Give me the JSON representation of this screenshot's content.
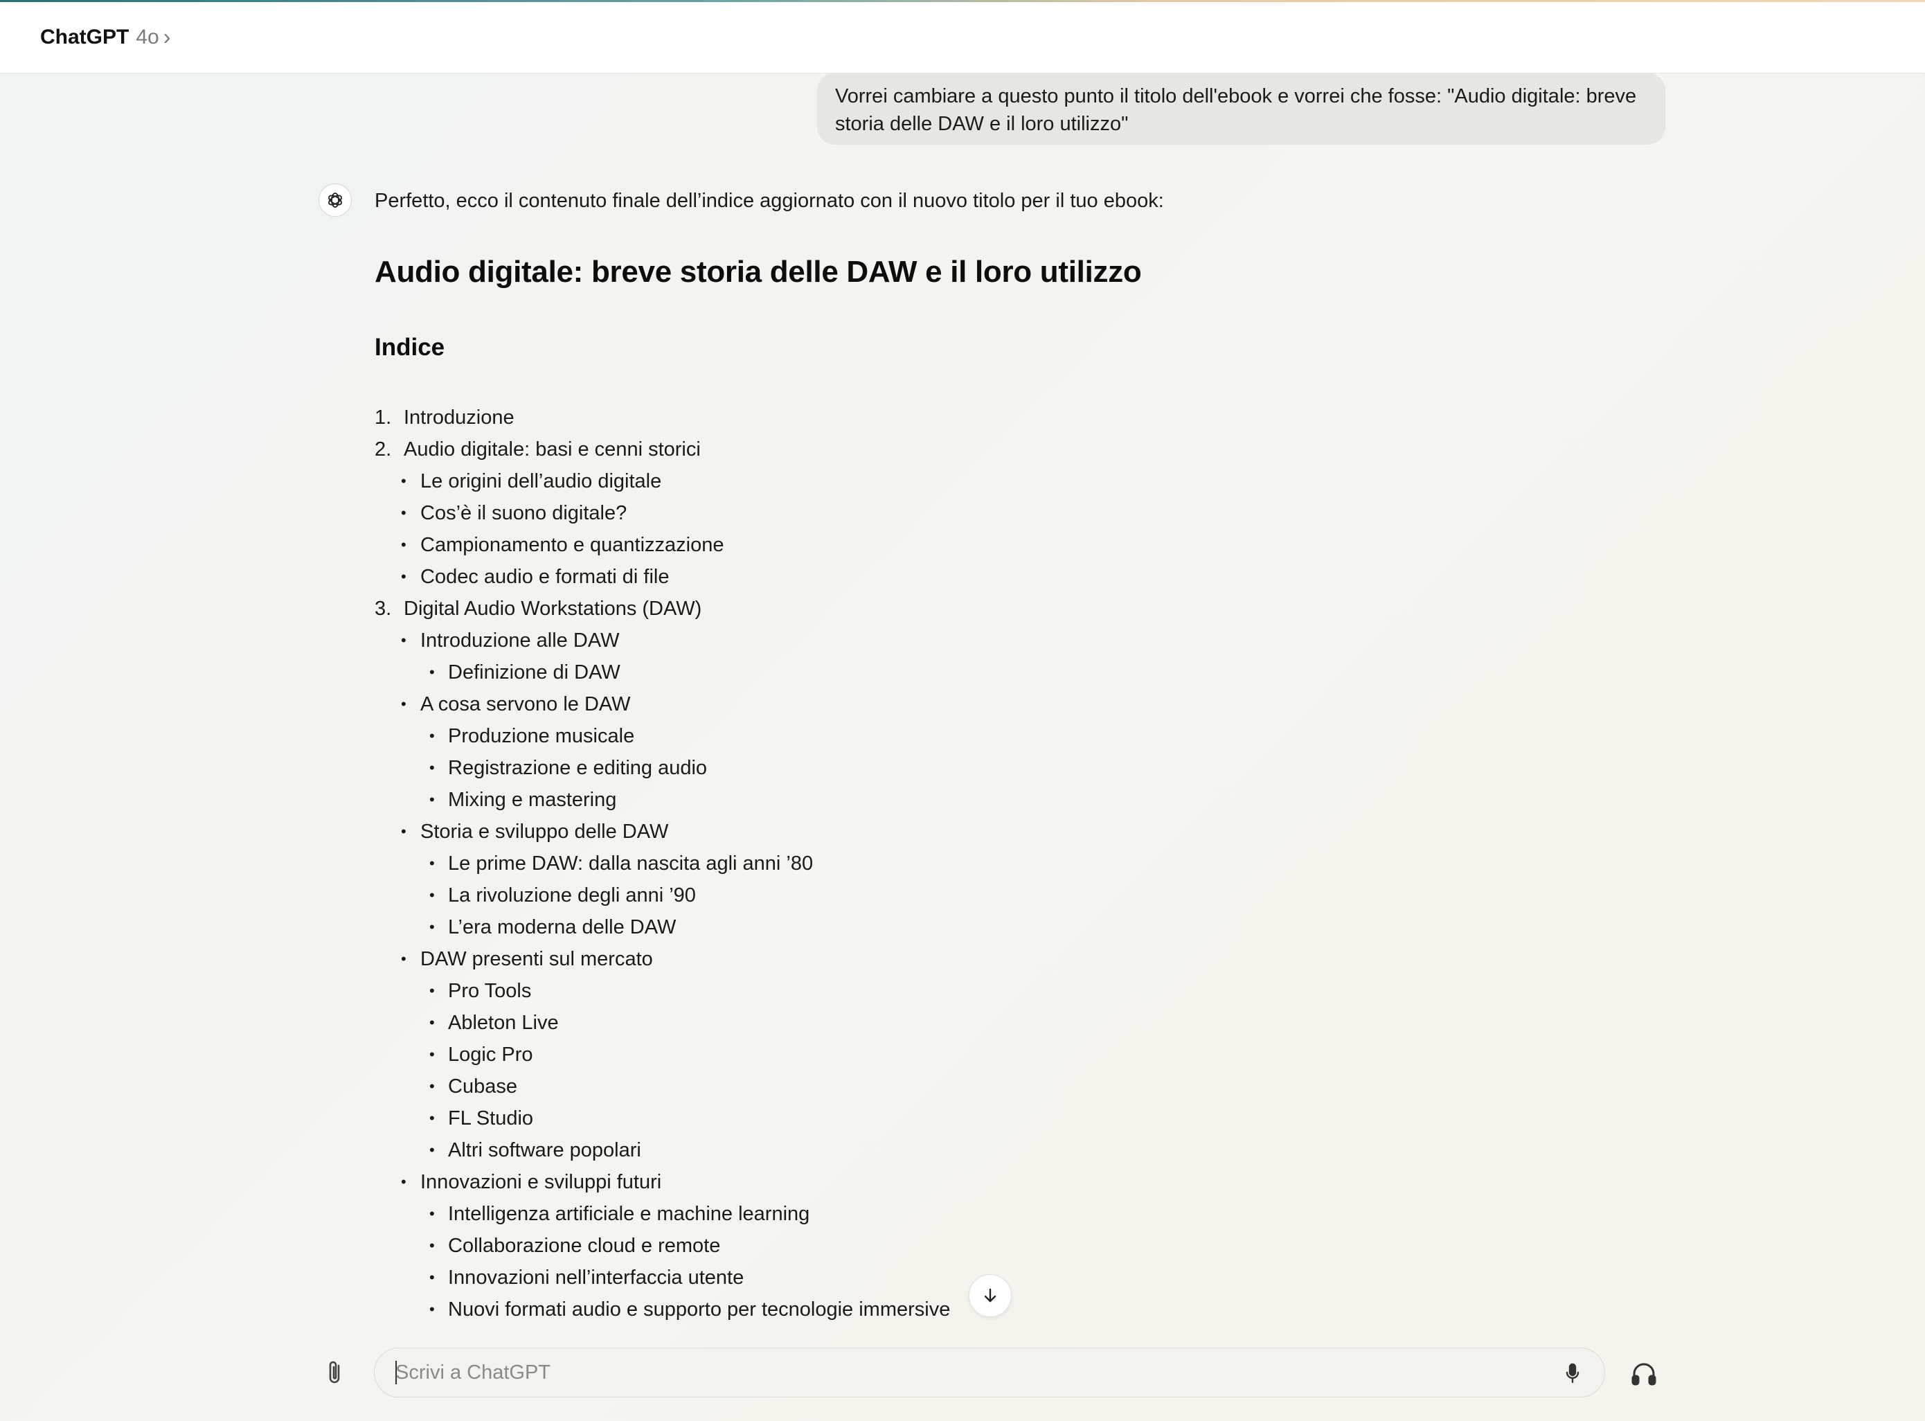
{
  "header": {
    "app_name": "ChatGPT",
    "model": "4o",
    "chevron": "›"
  },
  "user_message": "Vorrei cambiare a questo punto il titolo dell'ebook e vorrei che fosse: \"Audio digitale: breve storia delle DAW e il loro utilizzo\"",
  "assistant": {
    "intro": "Perfetto, ecco il contenuto finale dell’indice aggiornato con il nuovo titolo per il tuo ebook:",
    "ebook_title": "Audio digitale: breve storia delle DAW e il loro utilizzo",
    "index_title": "Indice",
    "toc": [
      {
        "level": 0,
        "marker": "1.",
        "text": "Introduzione"
      },
      {
        "level": 0,
        "marker": "2.",
        "text": "Audio digitale: basi e cenni storici"
      },
      {
        "level": 1,
        "marker": "•",
        "text": "Le origini dell’audio digitale"
      },
      {
        "level": 1,
        "marker": "•",
        "text": "Cos’è il suono digitale?"
      },
      {
        "level": 1,
        "marker": "•",
        "text": "Campionamento e quantizzazione"
      },
      {
        "level": 1,
        "marker": "•",
        "text": "Codec audio e formati di file"
      },
      {
        "level": 0,
        "marker": "3.",
        "text": "Digital Audio Workstations (DAW)"
      },
      {
        "level": 1,
        "marker": "•",
        "text": "Introduzione alle DAW"
      },
      {
        "level": 2,
        "marker": "•",
        "text": "Definizione di DAW"
      },
      {
        "level": 1,
        "marker": "•",
        "text": "A cosa servono le DAW"
      },
      {
        "level": 2,
        "marker": "•",
        "text": "Produzione musicale"
      },
      {
        "level": 2,
        "marker": "•",
        "text": "Registrazione e editing audio"
      },
      {
        "level": 2,
        "marker": "•",
        "text": "Mixing e mastering"
      },
      {
        "level": 1,
        "marker": "•",
        "text": "Storia e sviluppo delle DAW"
      },
      {
        "level": 2,
        "marker": "•",
        "text": "Le prime DAW: dalla nascita agli anni ’80"
      },
      {
        "level": 2,
        "marker": "•",
        "text": "La rivoluzione degli anni ’90"
      },
      {
        "level": 2,
        "marker": "•",
        "text": "L’era moderna delle DAW"
      },
      {
        "level": 1,
        "marker": "•",
        "text": "DAW presenti sul mercato"
      },
      {
        "level": 2,
        "marker": "•",
        "text": "Pro Tools"
      },
      {
        "level": 2,
        "marker": "•",
        "text": "Ableton Live"
      },
      {
        "level": 2,
        "marker": "•",
        "text": "Logic Pro"
      },
      {
        "level": 2,
        "marker": "•",
        "text": "Cubase"
      },
      {
        "level": 2,
        "marker": "•",
        "text": "FL Studio"
      },
      {
        "level": 2,
        "marker": "•",
        "text": "Altri software popolari"
      },
      {
        "level": 1,
        "marker": "•",
        "text": "Innovazioni e sviluppi futuri"
      },
      {
        "level": 2,
        "marker": "•",
        "text": "Intelligenza artificiale e machine learning"
      },
      {
        "level": 2,
        "marker": "•",
        "text": "Collaborazione cloud e remote"
      },
      {
        "level": 2,
        "marker": "•",
        "text": "Innovazioni nell’interfaccia utente"
      },
      {
        "level": 2,
        "marker": "•",
        "text": "Nuovi formati audio e supporto per tecnologie immersive"
      }
    ]
  },
  "composer": {
    "placeholder": "Scrivi a ChatGPT",
    "value": ""
  },
  "icons": {
    "logo": "openai-logo-icon",
    "scroll": "arrow-down-icon",
    "attach": "paperclip-icon",
    "mic": "microphone-icon",
    "voice": "headphones-icon"
  },
  "colors": {
    "user_bubble": "#e7e7e2",
    "text": "#0d0d0d",
    "muted": "#7a7a7a"
  }
}
